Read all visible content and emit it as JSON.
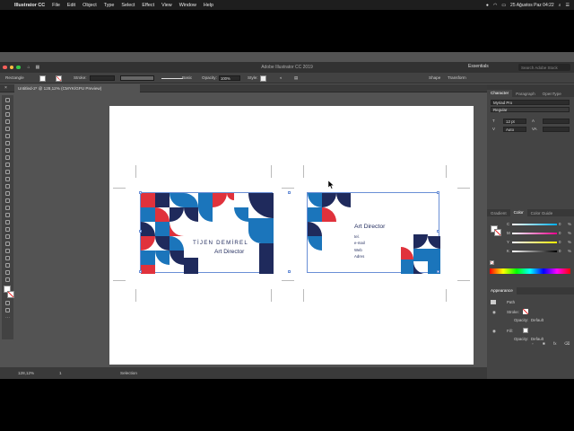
{
  "menubar": {
    "app_name": "Illustrator CC",
    "items": [
      "File",
      "Edit",
      "Object",
      "Type",
      "Select",
      "Effect",
      "View",
      "Window",
      "Help"
    ],
    "datetime": "25 Ağustos Paz  04:22"
  },
  "appbar": {
    "title": "Adobe Illustrator CC 2019",
    "workspace": "Essentials",
    "search_placeholder": "Search Adobe Stock"
  },
  "control_bar": {
    "selection_label": "Rectangle",
    "stroke_label": "Stroke:",
    "brush_label": "Basic",
    "opacity_label": "Opacity:",
    "opacity_value": "100%",
    "style_label": "Style:",
    "shape_label": "Shape",
    "transform_label": "Transform"
  },
  "document_tab": {
    "label": "Untitled-2* @ 128,12% (CMYK/GPU Preview)"
  },
  "cards": {
    "front_name": "TİJEN DEMİREL",
    "front_title": "Art Director",
    "back_title": "Art Director",
    "back_lines": [
      "tel.",
      "e-mail",
      "Web",
      "Adres"
    ]
  },
  "status_bar": {
    "zoom": "128,12%",
    "artboard": "1",
    "mode": "Selection"
  },
  "character_panel": {
    "tabs": [
      "Character",
      "Paragraph",
      "OpenType"
    ],
    "font_family": "Myriad Pro",
    "font_style": "Regular",
    "font_size": "12 pt",
    "leading": "Auto"
  },
  "color_panel": {
    "tabs": [
      "Gradient",
      "Color",
      "Color Guide"
    ],
    "channels": [
      "C",
      "M",
      "Y",
      "K"
    ],
    "values": [
      "0",
      "0",
      "0",
      "0"
    ],
    "percent": "%"
  },
  "appearance_panel": {
    "title": "Appearance",
    "path_label": "Path",
    "stroke_label": "Stroke:",
    "opacity_label": "Opacity:",
    "opacity_value": "Default",
    "fill_label": "Fill:",
    "opacity2_value": "Default"
  },
  "colors": {
    "red": "#e0323c",
    "blue": "#1b75bb",
    "navy": "#1f2a5c",
    "text_navy": "#1f2a5c"
  }
}
